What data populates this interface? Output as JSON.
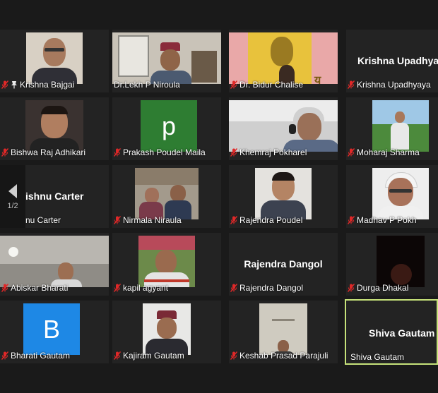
{
  "page_indicator": "1/2",
  "colors": {
    "background": "#1a1a1a",
    "tile": "#232323",
    "active_speaker_border": "#c6e27a",
    "mute_red": "#e02828",
    "prakash_avatar": "#2e7d32",
    "bharati_avatar": "#1e88e5"
  },
  "participants": [
    {
      "name": "Krishna Bajgai",
      "muted": true,
      "pinned": true
    },
    {
      "name": "Dr.Lekh P Niroula",
      "muted": false
    },
    {
      "name": "Dr. Bidur Chalise",
      "muted": true
    },
    {
      "name": "Krishna Upadhyaya",
      "display_name": "Krishna  Upadhyaya",
      "muted": true,
      "video_off": true
    },
    {
      "name": "Bishwa Raj Adhikari",
      "muted": true
    },
    {
      "name": "Prakash Poudel Maila",
      "muted": true,
      "avatar_letter": "p"
    },
    {
      "name": "Khemraj Pokharel",
      "muted": true
    },
    {
      "name": "Moharaj Sharma",
      "muted": true
    },
    {
      "name": "nu Carter",
      "display_name": "ishnu Carter",
      "muted": false,
      "video_off": true
    },
    {
      "name": "Nirmala Niraula",
      "muted": true
    },
    {
      "name": "Rajendra Poudel",
      "muted": true
    },
    {
      "name": "Madhav P Pokh",
      "muted": true
    },
    {
      "name": "Abiskar Bharati",
      "muted": true
    },
    {
      "name": "kapil agyant",
      "muted": true
    },
    {
      "name": "Rajendra Dangol",
      "display_name": "Rajendra Dangol",
      "muted": true,
      "video_off": true
    },
    {
      "name": "Durga Dhakal",
      "muted": true
    },
    {
      "name": "Bharati Gautam",
      "muted": true,
      "avatar_letter": "B"
    },
    {
      "name": "Kajiram Gautam",
      "muted": true
    },
    {
      "name": "Keshab Prasad Parajuli",
      "muted": true
    },
    {
      "name": "Shiva Gautam",
      "display_name": "Shiva Gautam",
      "muted": false,
      "video_off": true,
      "active_speaker": true
    }
  ]
}
